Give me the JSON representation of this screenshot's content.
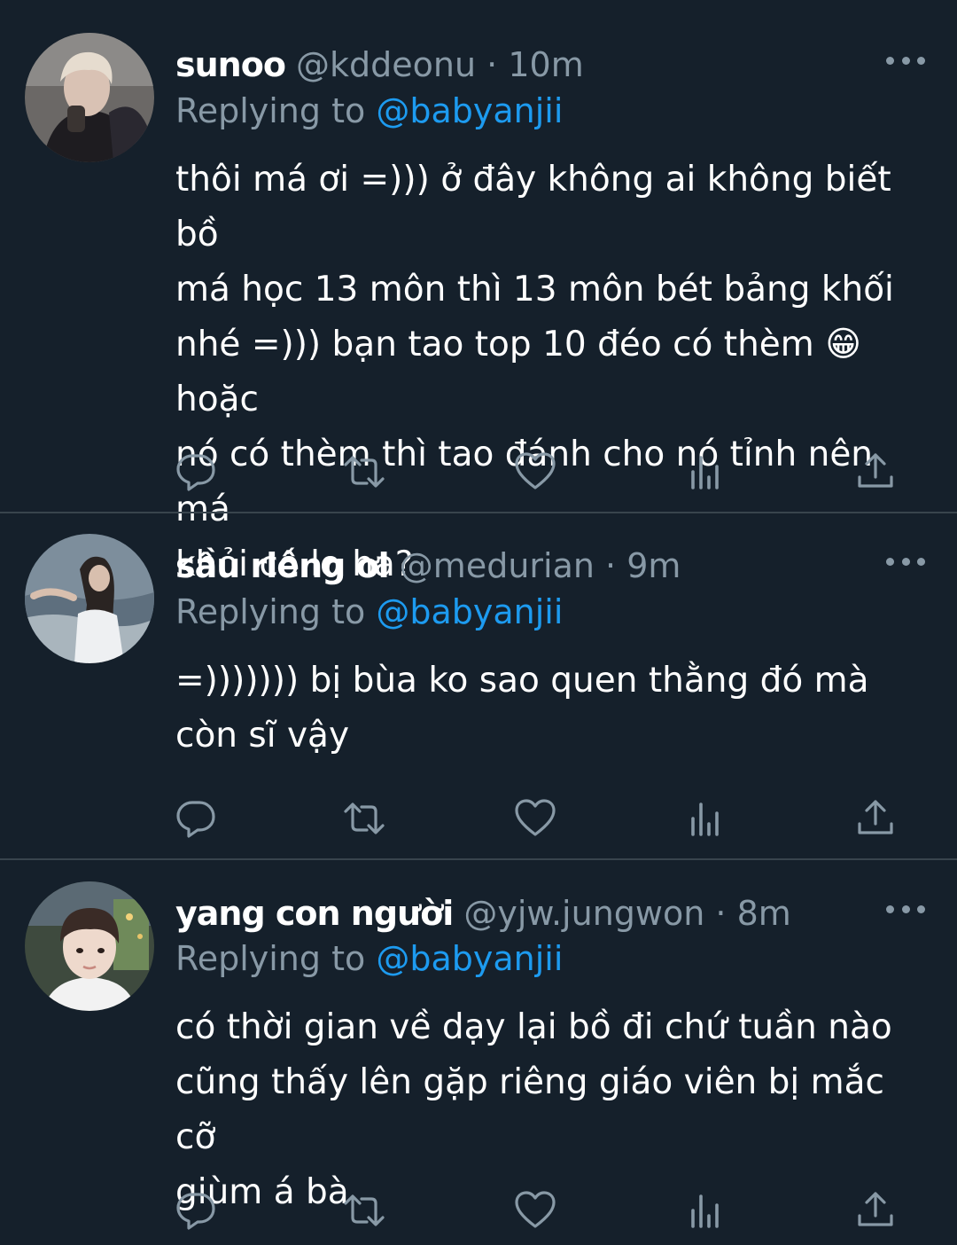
{
  "tweets": [
    {
      "name": "sunoo",
      "handle": "@kddeonu",
      "separator": "·",
      "time": "10m",
      "replying_prefix": "Replying to",
      "replying_to": "@babyanjii",
      "text_before_emoji": "thôi má ơi =))) ở đây không ai không biết bồ\nmá học 13 môn thì 13 môn bét bảng khối\nnhé =))) bạn tao top 10 đéo có thèm ",
      "emoji": "😁",
      "text_after_emoji": " hoặc\nnó có thèm thì tao đánh cho nó tỉnh nên má\nkhỏi có lo ha?"
    },
    {
      "name": "sầu riêng ơi",
      "handle": "@medurian",
      "separator": "·",
      "time": "9m",
      "replying_prefix": "Replying to",
      "replying_to": "@babyanjii",
      "text": "=))))))) bị bùa ko sao quen thằng đó mà\ncòn sĩ vậy"
    },
    {
      "name": "yang con người",
      "handle": "@yjw.jungwon",
      "separator": "·",
      "time": "8m",
      "replying_prefix": "Replying to",
      "replying_to": "@babyanjii",
      "text": "có thời gian về dạy lại bồ đi chứ tuần nào\ncũng thấy lên gặp riêng giáo viên bị mắc cỡ\ngiùm á bà"
    }
  ],
  "icons": {
    "reply": "reply-icon",
    "retweet": "retweet-icon",
    "like": "heart-icon",
    "views": "views-icon",
    "share": "share-icon",
    "more": "more-icon"
  },
  "colors": {
    "background": "#15202b",
    "secondary_text": "#8899a6",
    "mention": "#1d9bf0",
    "divider": "#38444d"
  }
}
